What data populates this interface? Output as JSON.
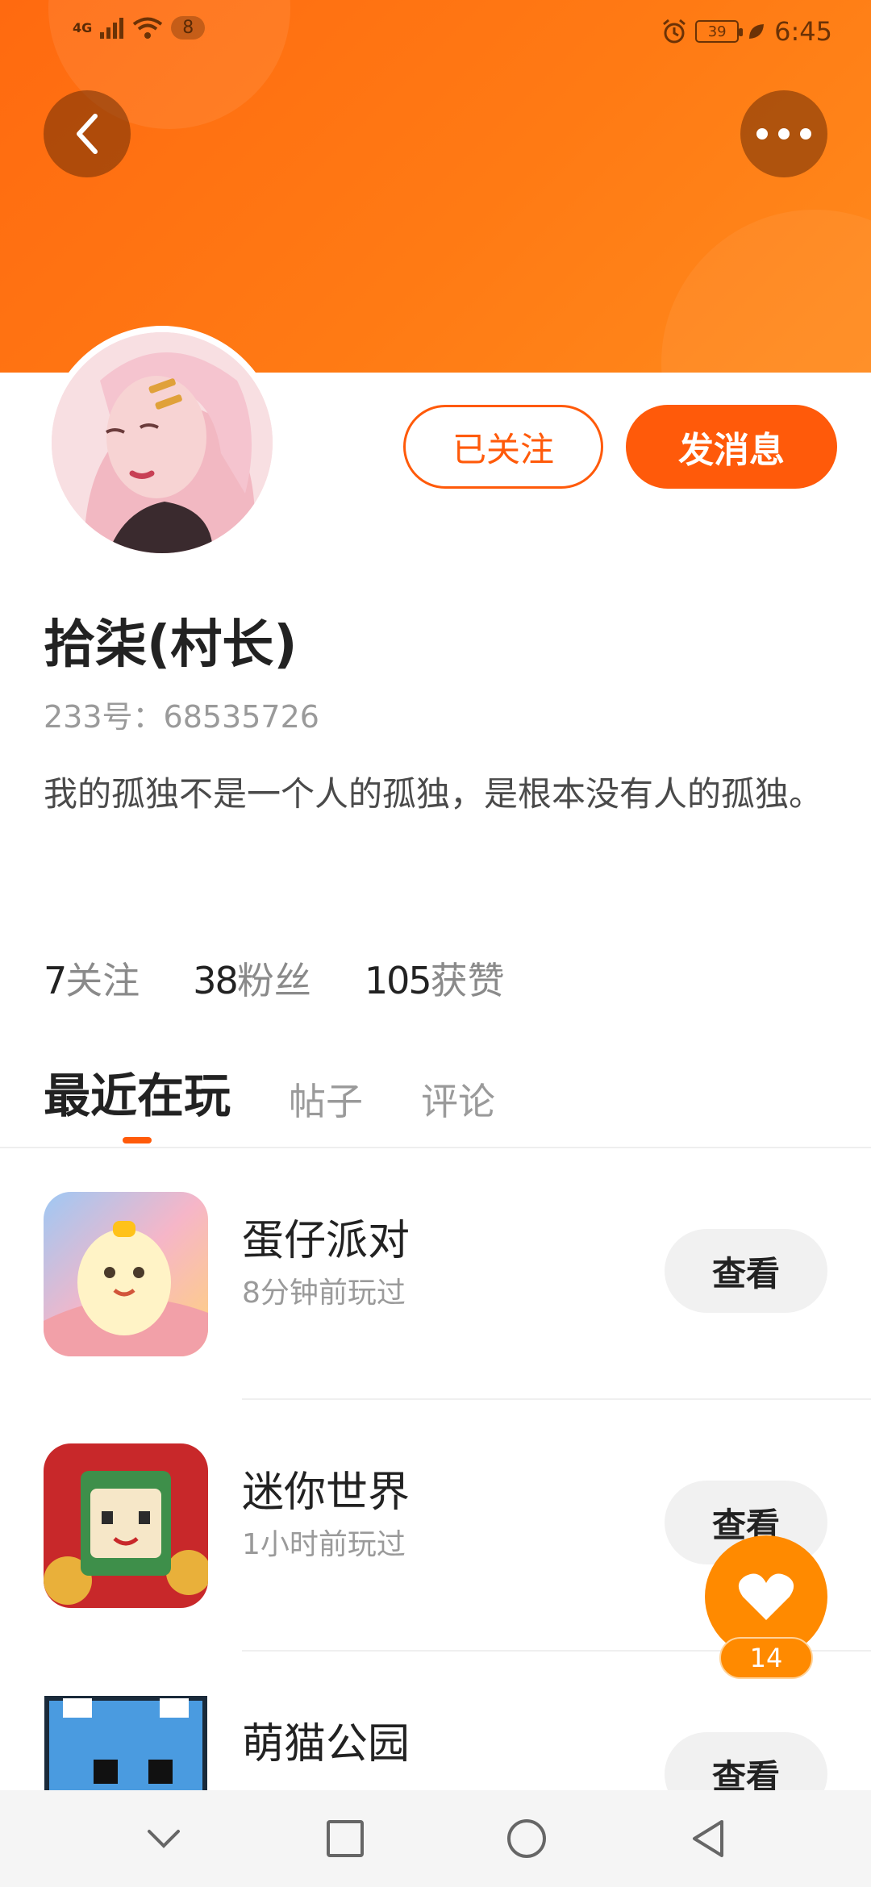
{
  "status_bar": {
    "network": "4G",
    "notification_count": "8",
    "battery": "39",
    "time": "6:45"
  },
  "header": {
    "back_icon": "chevron-left-icon",
    "more_icon": "more-dots-icon"
  },
  "profile": {
    "name": "拾柒(村长)",
    "id_line": "233号：68535726",
    "bio": "我的孤独不是一个人的孤独，是根本没有人的孤独。",
    "follow_label": "已关注",
    "message_label": "发消息"
  },
  "stats": [
    {
      "value": "7",
      "label": "关注"
    },
    {
      "value": "38",
      "label": "粉丝"
    },
    {
      "value": "105",
      "label": "获赞"
    }
  ],
  "tabs": [
    {
      "label": "最近在玩",
      "active": true
    },
    {
      "label": "帖子",
      "active": false
    },
    {
      "label": "评论",
      "active": false
    }
  ],
  "games": [
    {
      "title": "蛋仔派对",
      "played": "8分钟前玩过",
      "button": "查看"
    },
    {
      "title": "迷你世界",
      "played": "1小时前玩过",
      "button": "查看"
    },
    {
      "title": "萌猫公园",
      "played": "",
      "button": "查看"
    }
  ],
  "like_fab": {
    "icon": "heart-icon",
    "count": "14"
  },
  "nav": [
    "chevron-down-icon",
    "square-icon",
    "circle-icon",
    "triangle-back-icon"
  ],
  "colors": {
    "brand": "#ff5a0a",
    "banner": "#ff7a14",
    "like": "#ff8a00"
  }
}
